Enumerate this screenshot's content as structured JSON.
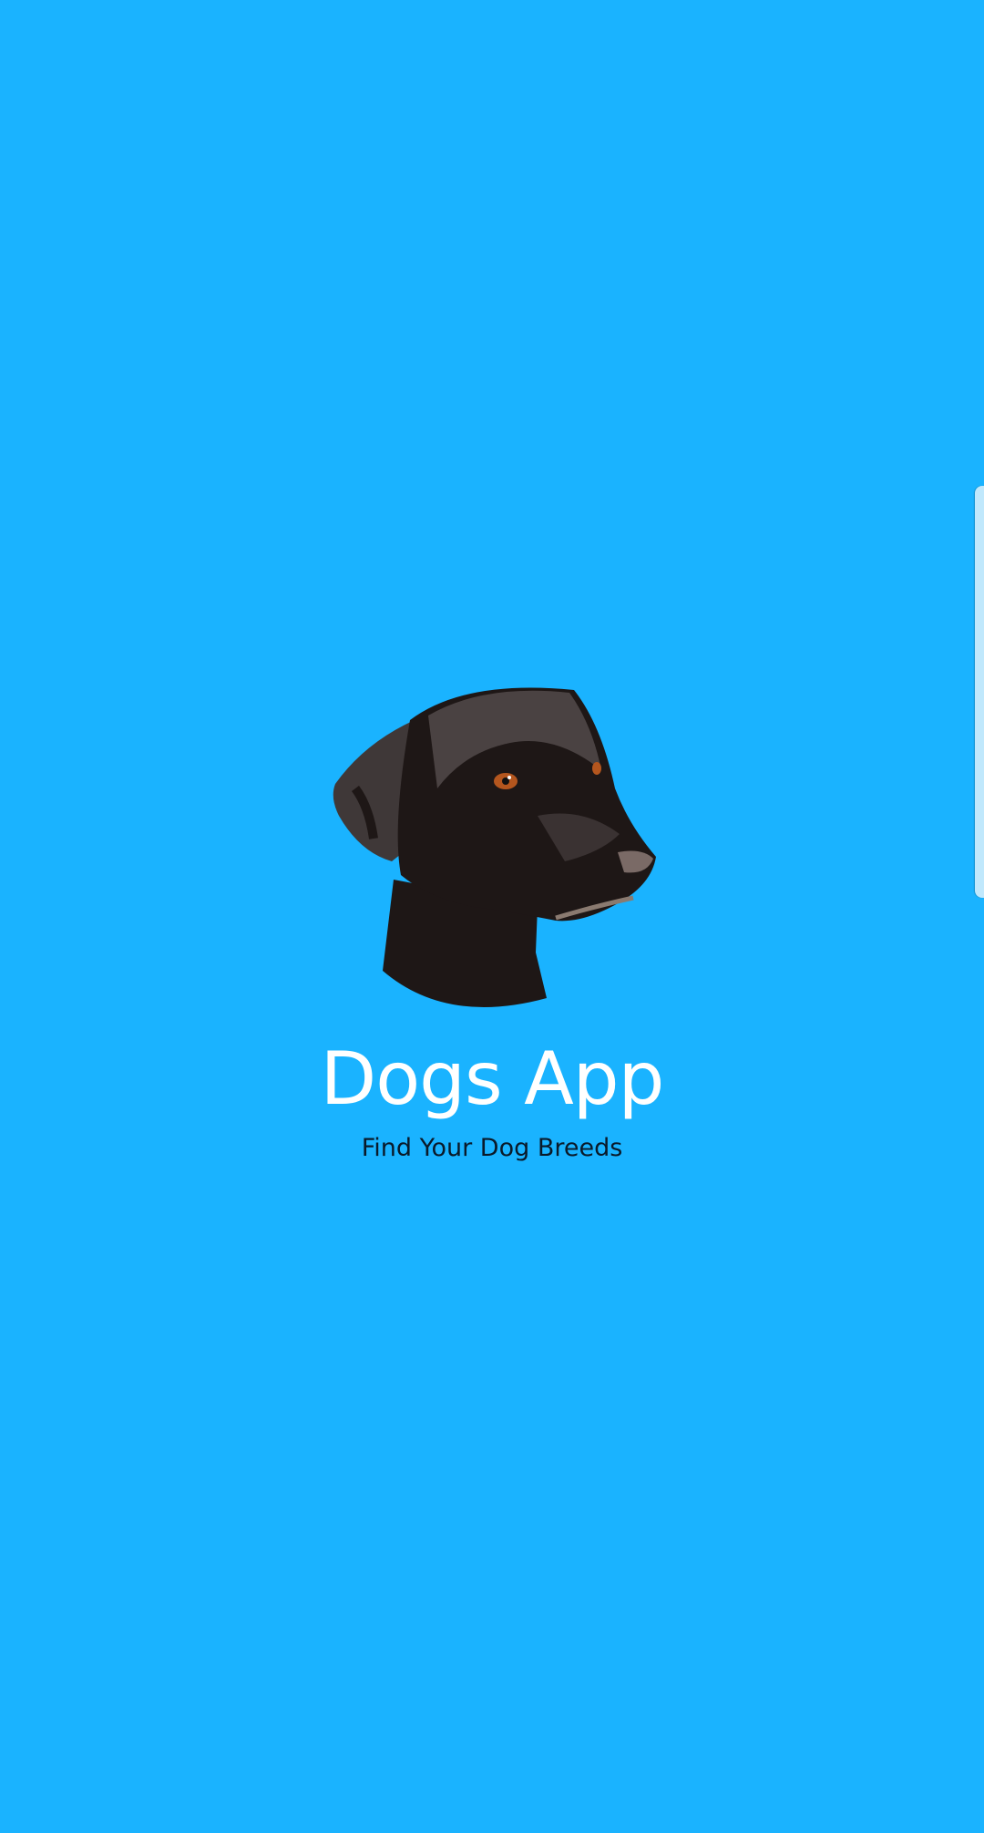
{
  "app": {
    "title": "Dogs App",
    "subtitle": "Find Your Dog Breeds",
    "logo_icon": "dog-head-icon"
  },
  "colors": {
    "background": "#1ab3ff",
    "title": "#ffffff",
    "subtitle": "#0a1a2a",
    "edge_handle": "#c0e8fc"
  }
}
